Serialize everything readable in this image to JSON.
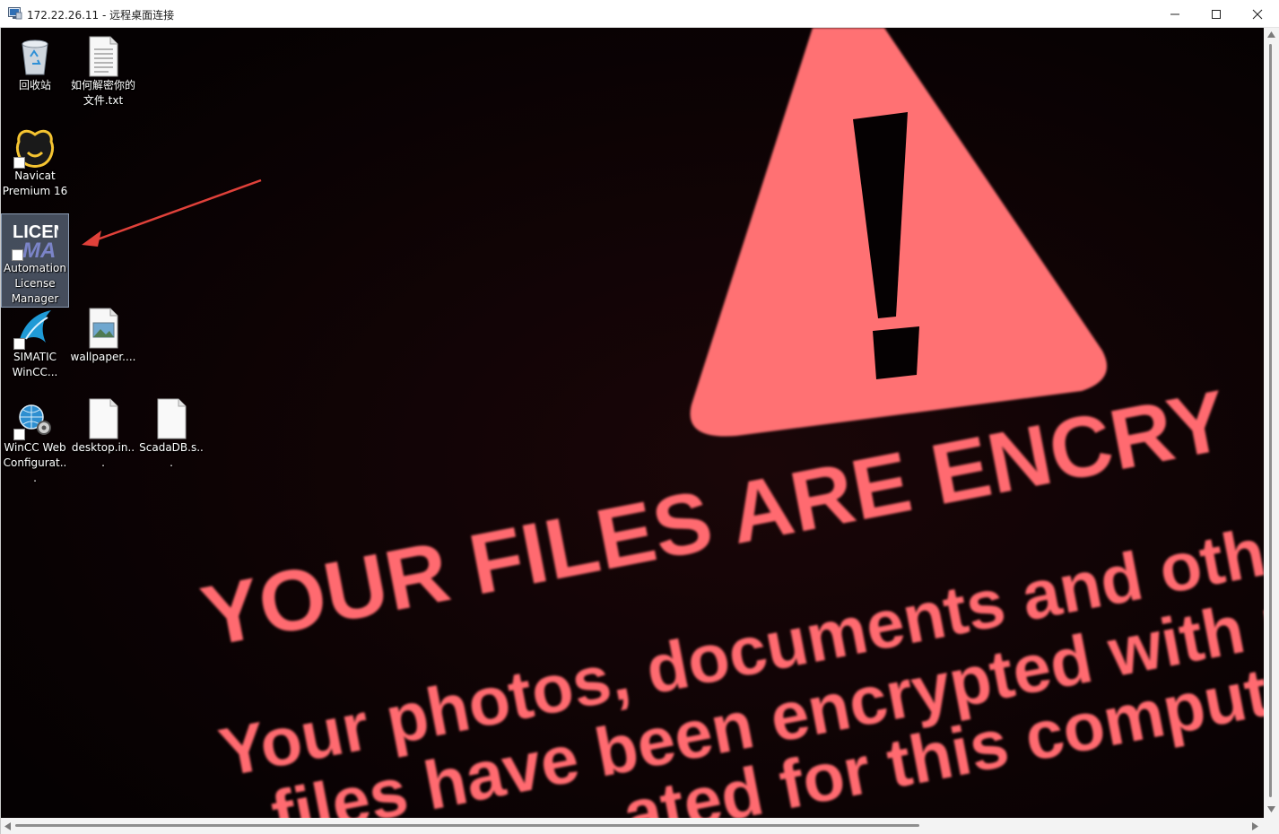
{
  "window": {
    "title": "172.22.26.11 - 远程桌面连接",
    "controls": [
      "minimize",
      "maximize",
      "close"
    ]
  },
  "desktop_icons": [
    {
      "name": "recycle-bin",
      "label": "回收站",
      "icon": "recycle-bin-icon"
    },
    {
      "name": "decrypt-note",
      "label": "如何解密你的文件.txt",
      "icon": "text-file-icon"
    },
    {
      "name": "navicat",
      "label": "Navicat Premium 16",
      "icon": "navicat-icon",
      "shortcut": true
    },
    {
      "name": "automation-license-manager",
      "label": "Automation License Manager",
      "icon": "license-manager-icon",
      "shortcut": true,
      "selected": true
    },
    {
      "name": "simatic-wincc",
      "label": "SIMATIC WinCC...",
      "icon": "wincc-icon",
      "shortcut": true
    },
    {
      "name": "wallpaper",
      "label": "wallpaper....",
      "icon": "image-file-icon"
    },
    {
      "name": "wincc-web-config",
      "label": "WinCC Web Configurat...",
      "icon": "wincc-web-icon",
      "shortcut": true
    },
    {
      "name": "desktop-ini",
      "label": "desktop.in...",
      "icon": "blank-file-icon"
    },
    {
      "name": "scadadb",
      "label": "ScadaDB.s...",
      "icon": "blank-file-icon"
    }
  ],
  "license_icon_text": {
    "top": "LICEN",
    "bottom": "MA"
  },
  "wallpaper": {
    "headline": "YOUR FILES ARE ENCRY",
    "line1": "Your photos, documents and other",
    "line2": "files have been encrypted with uni",
    "line3": "ated for this compute",
    "warning_symbol": "!",
    "accent": "#ff6b6f",
    "background": "#060203"
  },
  "annotation": {
    "type": "red-arrow",
    "color": "#e0413a",
    "points_to": "automation-license-manager"
  }
}
